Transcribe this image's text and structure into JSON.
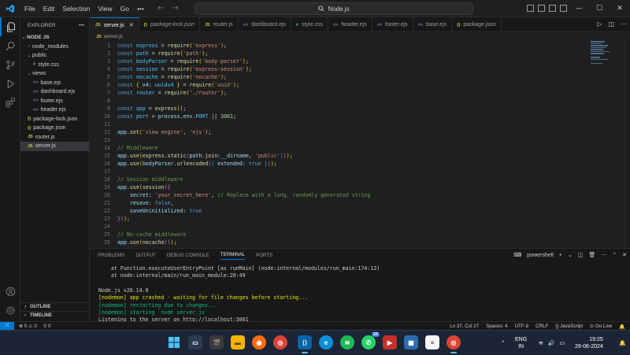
{
  "titlebar": {
    "menu": [
      "File",
      "Edit",
      "Selection",
      "View",
      "Go"
    ],
    "more": "•••",
    "search": "Node.js",
    "window_controls": {
      "minimize": "—",
      "maximize": "☐",
      "close": "✕"
    }
  },
  "sidebar": {
    "title": "EXPLORER",
    "more": "•••",
    "root": "NODE JS",
    "tree": [
      {
        "label": "node_modules",
        "type": "folder",
        "depth": 1,
        "expanded": false
      },
      {
        "label": "public",
        "type": "folder",
        "depth": 1,
        "expanded": true
      },
      {
        "label": "style.css",
        "type": "css",
        "depth": 2
      },
      {
        "label": "views",
        "type": "folder",
        "depth": 1,
        "expanded": true
      },
      {
        "label": "base.ejs",
        "type": "ejs",
        "depth": 2
      },
      {
        "label": "dashboard.ejs",
        "type": "ejs",
        "depth": 2
      },
      {
        "label": "footer.ejs",
        "type": "ejs",
        "depth": 2
      },
      {
        "label": "header.ejs",
        "type": "ejs",
        "depth": 2
      },
      {
        "label": "package-lock.json",
        "type": "json",
        "depth": 1
      },
      {
        "label": "package.json",
        "type": "json",
        "depth": 1
      },
      {
        "label": "router.js",
        "type": "js",
        "depth": 1
      },
      {
        "label": "server.js",
        "type": "js",
        "depth": 1,
        "selected": true
      }
    ],
    "outline": "OUTLINE",
    "timeline": "TIMELINE"
  },
  "tabs": [
    {
      "label": "server.js",
      "type": "js",
      "active": true
    },
    {
      "label": "package-lock.json",
      "type": "json",
      "italic": true
    },
    {
      "label": "router.js",
      "type": "js"
    },
    {
      "label": "dashboard.ejs",
      "type": "ejs"
    },
    {
      "label": "style.css",
      "type": "css"
    },
    {
      "label": "header.ejs",
      "type": "ejs"
    },
    {
      "label": "footer.ejs",
      "type": "ejs"
    },
    {
      "label": "base.ejs",
      "type": "ejs"
    },
    {
      "label": "package.json",
      "type": "json"
    }
  ],
  "breadcrumb": {
    "icon": "JS",
    "file": "server.js"
  },
  "editor": {
    "lines": [
      {
        "n": "1",
        "tokens": [
          [
            "kw",
            "const "
          ],
          [
            "vr",
            "express"
          ],
          [
            "pn",
            " = "
          ],
          [
            "fn",
            "require"
          ],
          [
            "br",
            "("
          ],
          [
            "st",
            "'express'"
          ],
          [
            "br",
            ")"
          ],
          [
            "pn",
            ";"
          ]
        ]
      },
      {
        "n": "2",
        "tokens": [
          [
            "kw",
            "const "
          ],
          [
            "vr",
            "path"
          ],
          [
            "pn",
            " = "
          ],
          [
            "fn",
            "require"
          ],
          [
            "br",
            "("
          ],
          [
            "st",
            "'path'"
          ],
          [
            "br",
            ")"
          ],
          [
            "pn",
            ";"
          ]
        ]
      },
      {
        "n": "3",
        "tokens": [
          [
            "kw",
            "const "
          ],
          [
            "vr",
            "bodyParser"
          ],
          [
            "pn",
            " = "
          ],
          [
            "fn",
            "require"
          ],
          [
            "br",
            "("
          ],
          [
            "st",
            "'body-parser'"
          ],
          [
            "br",
            ")"
          ],
          [
            "pn",
            ";"
          ]
        ]
      },
      {
        "n": "4",
        "tokens": [
          [
            "kw",
            "const "
          ],
          [
            "vr",
            "session"
          ],
          [
            "pn",
            " = "
          ],
          [
            "fn",
            "require"
          ],
          [
            "br",
            "("
          ],
          [
            "st",
            "'express-session'"
          ],
          [
            "br",
            ")"
          ],
          [
            "pn",
            ";"
          ]
        ]
      },
      {
        "n": "5",
        "tokens": [
          [
            "kw",
            "const "
          ],
          [
            "vr",
            "nocache"
          ],
          [
            "pn",
            " = "
          ],
          [
            "fn",
            "require"
          ],
          [
            "br",
            "("
          ],
          [
            "st",
            "'nocache'"
          ],
          [
            "br",
            ")"
          ],
          [
            "pn",
            ";"
          ]
        ]
      },
      {
        "n": "6",
        "tokens": [
          [
            "kw",
            "const "
          ],
          [
            "br",
            "{ "
          ],
          [
            "pr",
            "v4"
          ],
          [
            "pn",
            ": "
          ],
          [
            "vr",
            "uuidv4"
          ],
          [
            "br",
            " }"
          ],
          [
            "pn",
            " = "
          ],
          [
            "fn",
            "require"
          ],
          [
            "br",
            "("
          ],
          [
            "st",
            "'uuid'"
          ],
          [
            "br",
            ")"
          ],
          [
            "pn",
            ";"
          ]
        ]
      },
      {
        "n": "7",
        "tokens": [
          [
            "kw",
            "const "
          ],
          [
            "vr",
            "router"
          ],
          [
            "pn",
            " = "
          ],
          [
            "fn",
            "require"
          ],
          [
            "br",
            "("
          ],
          [
            "st",
            "'./router'"
          ],
          [
            "br",
            ")"
          ],
          [
            "pn",
            ";"
          ]
        ]
      },
      {
        "n": "8",
        "tokens": []
      },
      {
        "n": "9",
        "tokens": [
          [
            "kw",
            "const "
          ],
          [
            "vr",
            "app"
          ],
          [
            "pn",
            " = "
          ],
          [
            "fn",
            "express"
          ],
          [
            "br",
            "()"
          ],
          [
            "pn",
            ";"
          ]
        ]
      },
      {
        "n": "10",
        "tokens": [
          [
            "kw",
            "const "
          ],
          [
            "vr",
            "port"
          ],
          [
            "pn",
            " = "
          ],
          [
            "pr",
            "process"
          ],
          [
            "pn",
            "."
          ],
          [
            "pr",
            "env"
          ],
          [
            "pn",
            "."
          ],
          [
            "vr",
            "PORT"
          ],
          [
            "pn",
            " || "
          ],
          [
            "nm",
            "3001"
          ],
          [
            "pn",
            ";"
          ]
        ]
      },
      {
        "n": "11",
        "tokens": []
      },
      {
        "n": "12",
        "tokens": [
          [
            "pr",
            "app"
          ],
          [
            "pn",
            "."
          ],
          [
            "fn",
            "set"
          ],
          [
            "br",
            "("
          ],
          [
            "st",
            "'view engine'"
          ],
          [
            "pn",
            ", "
          ],
          [
            "st",
            "'ejs'"
          ],
          [
            "br",
            ")"
          ],
          [
            "pn",
            ";"
          ]
        ]
      },
      {
        "n": "13",
        "tokens": []
      },
      {
        "n": "14",
        "tokens": [
          [
            "cm",
            "// Middleware"
          ]
        ]
      },
      {
        "n": "15",
        "tokens": [
          [
            "pr",
            "app"
          ],
          [
            "pn",
            "."
          ],
          [
            "fn",
            "use"
          ],
          [
            "br",
            "("
          ],
          [
            "fn",
            "express"
          ],
          [
            "pn",
            "."
          ],
          [
            "fn",
            "static"
          ],
          [
            "br2",
            "("
          ],
          [
            "pr",
            "path"
          ],
          [
            "pn",
            "."
          ],
          [
            "fn",
            "join"
          ],
          [
            "br3",
            "("
          ],
          [
            "pr",
            "__dirname"
          ],
          [
            "pn",
            ", "
          ],
          [
            "st",
            "'public'"
          ],
          [
            "br3",
            ")"
          ],
          [
            "br2",
            ")"
          ],
          [
            "br",
            ")"
          ],
          [
            "pn",
            ";"
          ]
        ]
      },
      {
        "n": "16",
        "tokens": [
          [
            "pr",
            "app"
          ],
          [
            "pn",
            "."
          ],
          [
            "fn",
            "use"
          ],
          [
            "br",
            "("
          ],
          [
            "pr",
            "bodyParser"
          ],
          [
            "pn",
            "."
          ],
          [
            "fn",
            "urlencoded"
          ],
          [
            "br2",
            "("
          ],
          [
            "br3",
            "{ "
          ],
          [
            "pr",
            "extended"
          ],
          [
            "pn",
            ": "
          ],
          [
            "kw",
            "true"
          ],
          [
            "br3",
            " }"
          ],
          [
            "br2",
            ")"
          ],
          [
            "br",
            ")"
          ],
          [
            "pn",
            ";"
          ]
        ]
      },
      {
        "n": "17",
        "tokens": []
      },
      {
        "n": "18",
        "tokens": [
          [
            "cm",
            "// Session middleware"
          ]
        ]
      },
      {
        "n": "19",
        "tokens": [
          [
            "pr",
            "app"
          ],
          [
            "pn",
            "."
          ],
          [
            "fn",
            "use"
          ],
          [
            "br",
            "("
          ],
          [
            "fn",
            "session"
          ],
          [
            "br2",
            "({"
          ]
        ]
      },
      {
        "n": "20",
        "tokens": [
          [
            "pn",
            "    "
          ],
          [
            "pr",
            "secret"
          ],
          [
            "pn",
            ": "
          ],
          [
            "st",
            "'your_secret_here'"
          ],
          [
            "pn",
            ", "
          ],
          [
            "cm",
            "// Replace with a long, randomly generated string"
          ]
        ]
      },
      {
        "n": "21",
        "tokens": [
          [
            "pn",
            "    "
          ],
          [
            "pr",
            "resave"
          ],
          [
            "pn",
            ": "
          ],
          [
            "kw",
            "false"
          ],
          [
            "pn",
            ","
          ]
        ]
      },
      {
        "n": "22",
        "tokens": [
          [
            "pn",
            "    "
          ],
          [
            "pr",
            "saveUninitialized"
          ],
          [
            "pn",
            ": "
          ],
          [
            "kw",
            "true"
          ]
        ]
      },
      {
        "n": "23",
        "tokens": [
          [
            "br2",
            "})"
          ],
          [
            "br",
            ")"
          ],
          [
            "pn",
            ";"
          ]
        ]
      },
      {
        "n": "24",
        "tokens": []
      },
      {
        "n": "25",
        "tokens": [
          [
            "cm",
            "// No-cache middleware"
          ]
        ]
      },
      {
        "n": "26",
        "tokens": [
          [
            "pr",
            "app"
          ],
          [
            "pn",
            "."
          ],
          [
            "fn",
            "use"
          ],
          [
            "br",
            "("
          ],
          [
            "fn",
            "nocache"
          ],
          [
            "br2",
            "()"
          ],
          [
            "br",
            ")"
          ],
          [
            "pn",
            ";"
          ]
        ]
      },
      {
        "n": "27",
        "tokens": []
      }
    ]
  },
  "panel": {
    "tabs": [
      "PROBLEMS",
      "OUTPUT",
      "DEBUG CONSOLE",
      "TERMINAL",
      "PORTS"
    ],
    "active_tab": "TERMINAL",
    "shell": "powershell",
    "terminal": [
      {
        "text": "    at Function.executeUserEntryPoint [as runMain] (node:internal/modules/run_main:174:12)",
        "color": "default"
      },
      {
        "text": "    at node:internal/main/run_main_module:28:49",
        "color": "default"
      },
      {
        "text": "",
        "color": "default"
      },
      {
        "text": "Node.js v20.14.0",
        "color": "default"
      },
      {
        "text": "[nodemon] app crashed - waiting for file changes before starting...",
        "color": "yel"
      },
      {
        "text": "[nodemon] restarting due to changes...",
        "color": "grn"
      },
      {
        "text": "[nodemon] starting `node server.js`",
        "color": "grn"
      },
      {
        "text": "Listening to the server on http://localhost:3001",
        "color": "default"
      }
    ]
  },
  "statusbar": {
    "errors": "0",
    "warnings": "0",
    "ports": "0",
    "position": "Ln 37, Col 27",
    "spaces": "Spaces: 4",
    "encoding": "UTF-8",
    "eol": "CRLF",
    "language": "JavaScript",
    "golive": "Go Live"
  },
  "taskbar": {
    "lang": [
      "ENG",
      "IN"
    ],
    "time": "19:25",
    "date": "29-06-2024",
    "whatsapp_badge": "23"
  },
  "colors": {
    "accent": "#0078d4",
    "js": "#cbcb41",
    "json": "#cbcb41",
    "css": "#519aba",
    "ejs": "#a074c4"
  }
}
